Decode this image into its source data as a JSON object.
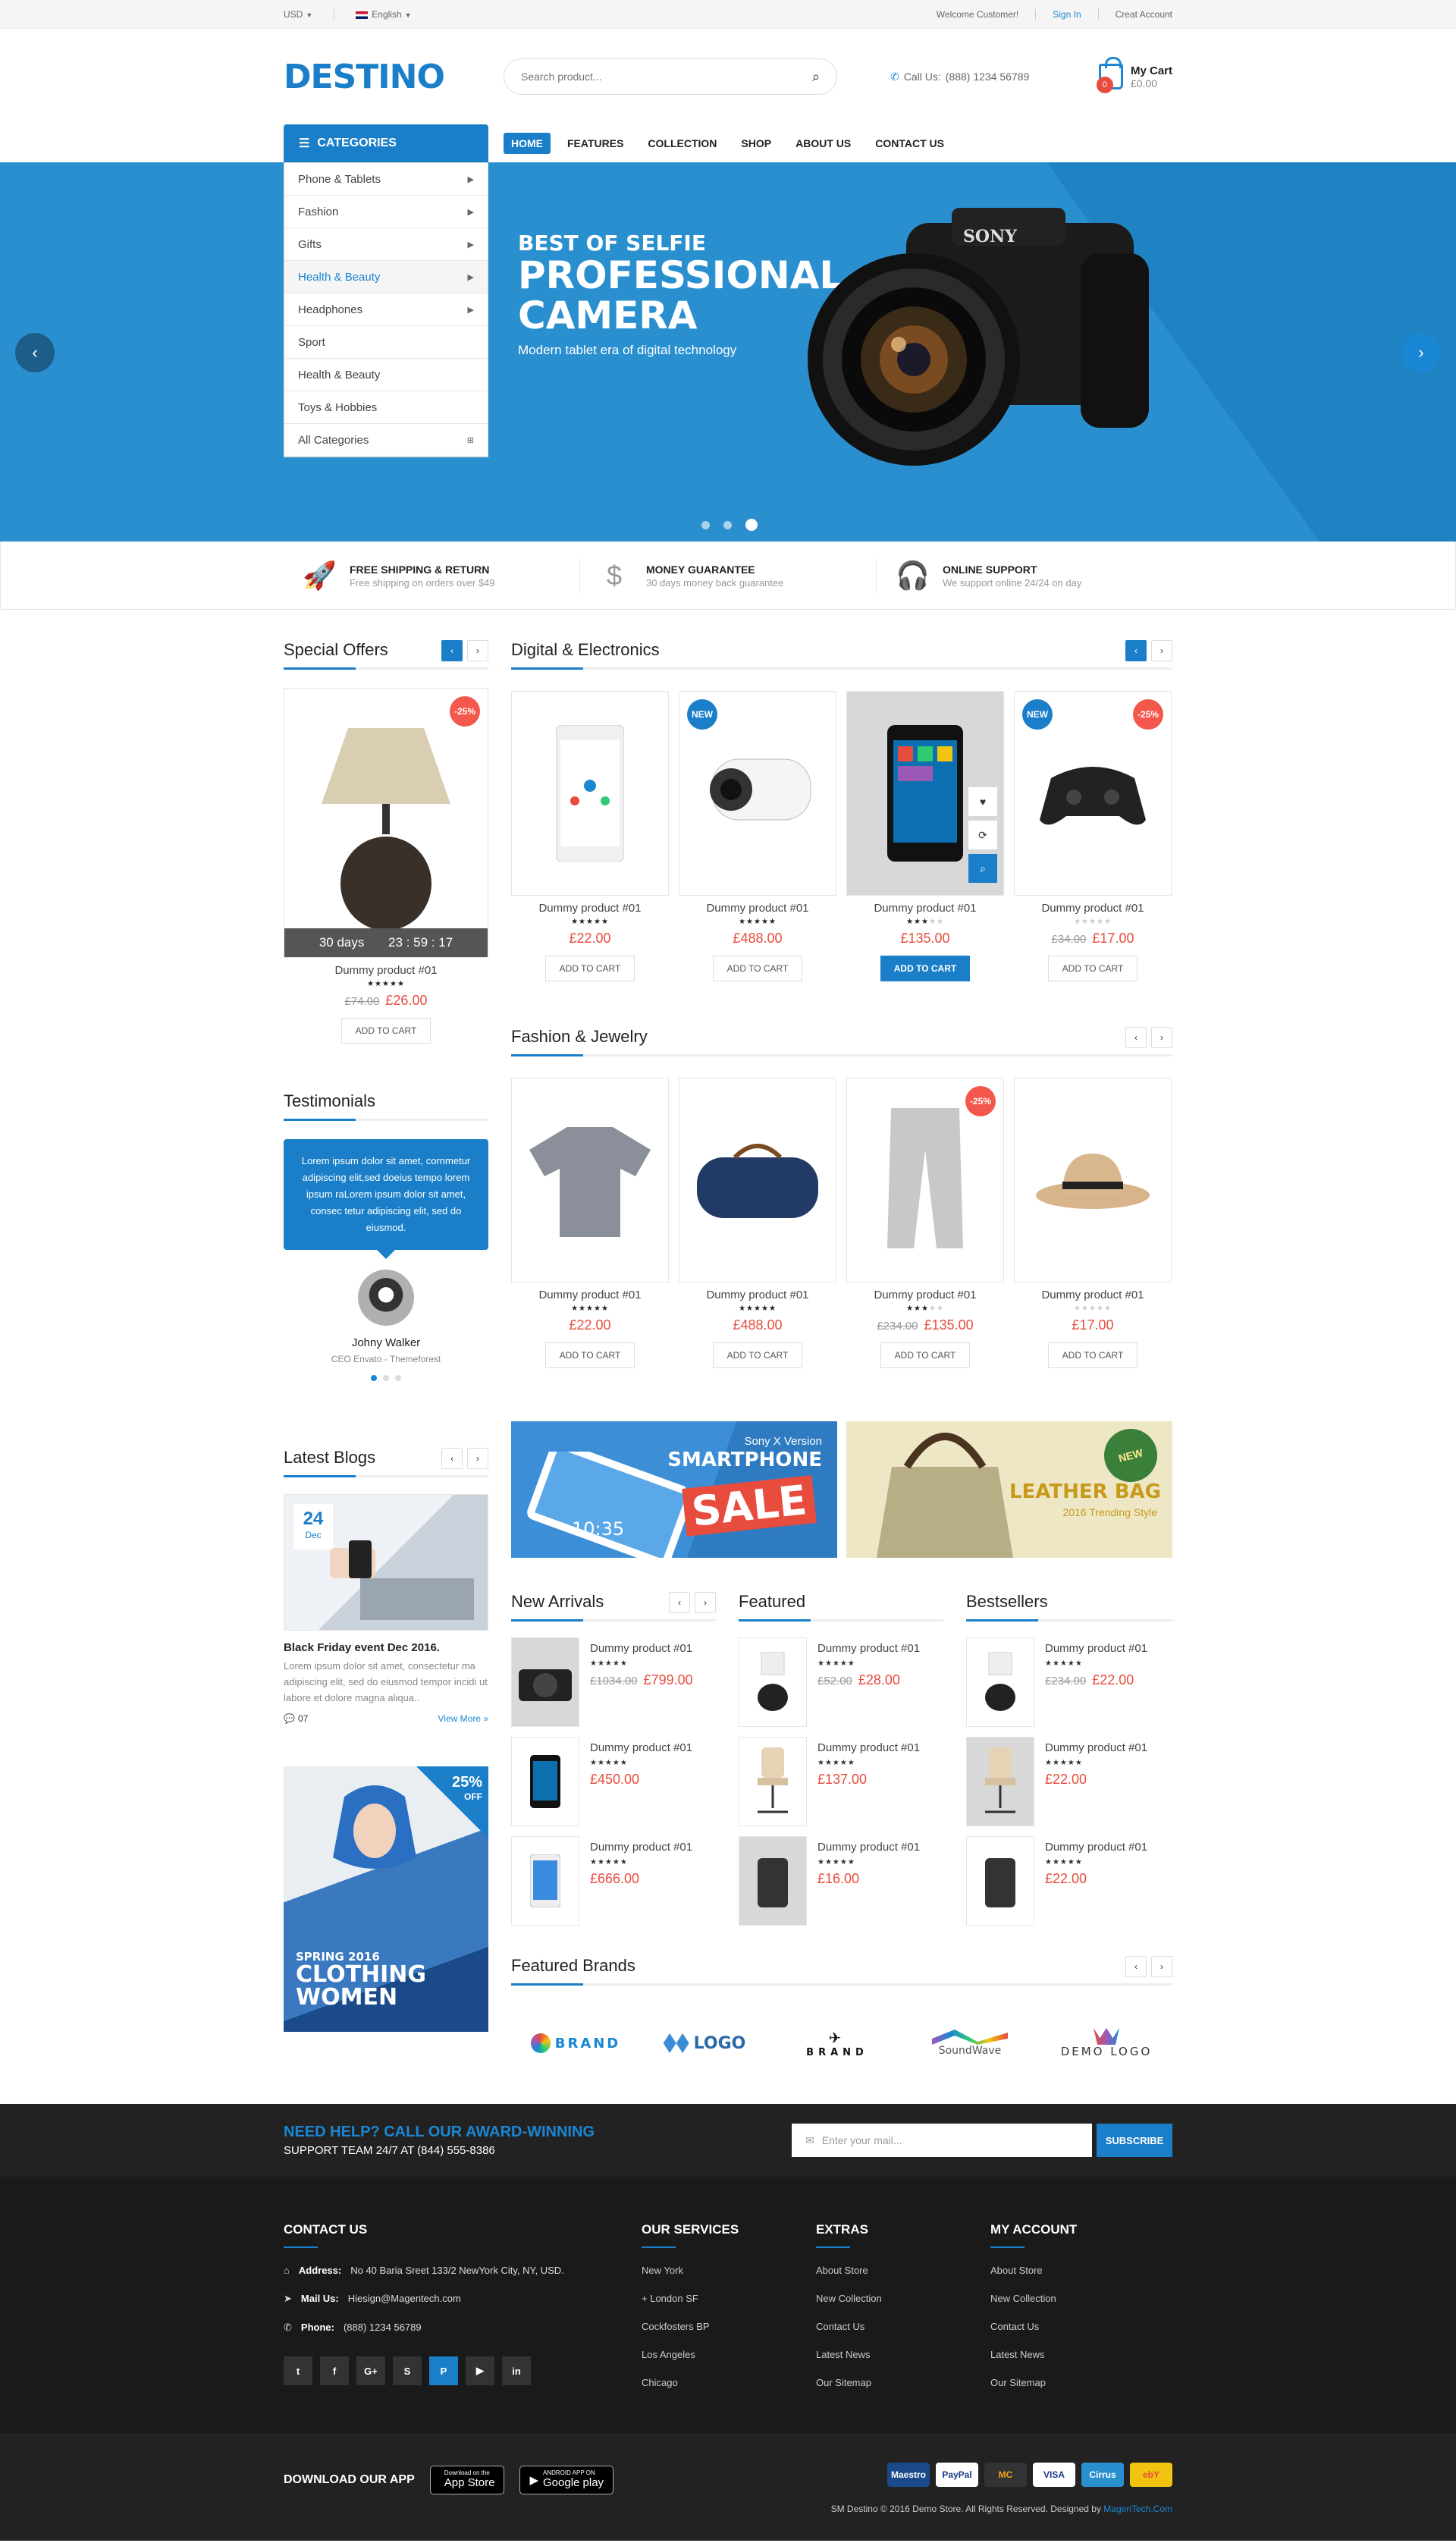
{
  "topbar": {
    "currency": "USD",
    "language": "English",
    "welcome": "Welcome Customer!",
    "signin": "Sign In",
    "create": "Creat Account"
  },
  "header": {
    "logo": "DESTINO",
    "search_placeholder": "Search product...",
    "call_label": "Call Us:",
    "phone": "(888) 1234 56789",
    "cart_title": "My Cart",
    "cart_total": "£0.00",
    "cart_count": "0"
  },
  "nav": {
    "categories_label": "CATEGORIES",
    "menu": [
      "HOME",
      "FEATURES",
      "COLLECTION",
      "SHOP",
      "ABOUT US",
      "CONTACT US"
    ]
  },
  "categories": [
    "Phone & Tablets",
    "Fashion",
    "Gifts",
    "Health & Beauty",
    "Headphones",
    "Sport",
    "Health & Beauty",
    "Toys & Hobbies",
    "All Categories"
  ],
  "slider": {
    "line1": "BEST OF SELFIE",
    "line2": "PROFESSIONAL",
    "line3": "CAMERA",
    "sub": "Modern tablet era of digital technology",
    "camera_brand": "SONY"
  },
  "services": [
    {
      "title": "FREE SHIPPING & RETURN",
      "desc": "Free shipping on orders over $49",
      "icon": "rocket-icon"
    },
    {
      "title": "MONEY GUARANTEE",
      "desc": "30 days money back guarantee",
      "icon": "money-bag-icon"
    },
    {
      "title": "ONLINE SUPPORT",
      "desc": "We support online 24/24 on day",
      "icon": "headphones-icon"
    }
  ],
  "special": {
    "title": "Special Offers",
    "badge": "-25%",
    "days": "30 days",
    "h": "23",
    "m": "59",
    "s": "17",
    "name": "Dummy product #01",
    "old": "£74.00",
    "price": "£26.00",
    "btn": "ADD TO CART"
  },
  "digital": {
    "title": "Digital & Electronics",
    "products": [
      {
        "name": "Dummy product #01",
        "price": "£22.00",
        "old": "",
        "rating": 5,
        "new": "",
        "sale": "",
        "btn": "ADD TO CART"
      },
      {
        "name": "Dummy product #01",
        "price": "£488.00",
        "old": "",
        "rating": 5,
        "new": "NEW",
        "sale": "",
        "btn": "ADD TO CART"
      },
      {
        "name": "Dummy product #01",
        "price": "£135.00",
        "old": "",
        "rating": 3,
        "new": "",
        "sale": "",
        "btn": "ADD TO CART"
      },
      {
        "name": "Dummy product #01",
        "price": "£17.00",
        "old": "£34.00",
        "rating": 0,
        "new": "NEW",
        "sale": "-25%",
        "btn": "ADD TO CART"
      }
    ]
  },
  "fashion": {
    "title": "Fashion & Jewelry",
    "products": [
      {
        "name": "Dummy product #01",
        "price": "£22.00",
        "old": "",
        "rating": 5,
        "sale": "",
        "btn": "ADD TO CART"
      },
      {
        "name": "Dummy product #01",
        "price": "£488.00",
        "old": "",
        "rating": 5,
        "sale": "",
        "btn": "ADD TO CART"
      },
      {
        "name": "Dummy product #01",
        "price": "£135.00",
        "old": "£234.00",
        "rating": 3,
        "sale": "-25%",
        "btn": "ADD TO CART"
      },
      {
        "name": "Dummy product #01",
        "price": "£17.00",
        "old": "",
        "rating": 0,
        "sale": "",
        "btn": "ADD TO CART"
      }
    ]
  },
  "testimonials": {
    "title": "Testimonials",
    "text": "Lorem ipsum dolor sit amet, cornmetur adipiscing elit,sed doeius tempo lorem ipsum raLorem ipsum dolor sit amet, consec tetur adipiscing elit, sed do eiusmod.",
    "name": "Johny Walker",
    "role": "CEO Envato - Themeforest"
  },
  "blogs": {
    "title": "Latest Blogs",
    "day": "24",
    "month": "Dec",
    "post_title": "Black Friday event Dec 2016.",
    "excerpt": "Lorem ipsum dolor sit amet, consectetur ma adipiscing elit, sed do eiusmod tempor incidi ut labore et dolore magna aliqua..",
    "comments": "07",
    "more": "View More »"
  },
  "promo": {
    "pct": "25%",
    "off": "OFF",
    "l1": "SPRING 2016",
    "l2": "CLOTHING",
    "l3": "WOMEN"
  },
  "banner1": {
    "small": "Sony X Version",
    "big": "SMARTPHONE",
    "sale": "SALE",
    "time": "10:35"
  },
  "banner2": {
    "big": "LEATHER BAG",
    "sub": "2016 Trending Style",
    "badge": "NEW"
  },
  "lists": [
    {
      "title": "New Arrivals",
      "items": [
        {
          "name": "Dummy product #01",
          "old": "£1034.00",
          "price": "£799.00"
        },
        {
          "name": "Dummy product #01",
          "old": "",
          "price": "£450.00"
        },
        {
          "name": "Dummy product #01",
          "old": "",
          "price": "£666.00"
        }
      ]
    },
    {
      "title": "Featured",
      "items": [
        {
          "name": "Dummy product #01",
          "old": "£52.00",
          "price": "£28.00"
        },
        {
          "name": "Dummy product #01",
          "old": "",
          "price": "£137.00"
        },
        {
          "name": "Dummy product #01",
          "old": "",
          "price": "£16.00"
        }
      ]
    },
    {
      "title": "Bestsellers",
      "items": [
        {
          "name": "Dummy product #01",
          "old": "£234.00",
          "price": "£22.00"
        },
        {
          "name": "Dummy product #01",
          "old": "",
          "price": "£22.00"
        },
        {
          "name": "Dummy product #01",
          "old": "",
          "price": "£22.00"
        }
      ]
    }
  ],
  "brands": {
    "title": "Featured Brands",
    "items": [
      "BRAND",
      "LOGO",
      "BRAND",
      "SoundWave",
      "DEMO LOGO"
    ]
  },
  "newsletter": {
    "heading": "NEED HELP? CALL OUR AWARD-WINNING",
    "sub": "SUPPORT TEAM 24/7 AT (844) 555-8386",
    "placeholder": "Enter your mail...",
    "btn": "SUBSCRIBE"
  },
  "footer": {
    "contact": {
      "title": "CONTACT US",
      "address_label": "Address:",
      "address": "No 40 Baria Sreet 133/2 NewYork City, NY, USD.",
      "mail_label": "Mail Us:",
      "mail": "Hiesign@Magentech.com",
      "phone_label": "Phone:",
      "phone": "(888) 1234 56789"
    },
    "socials": [
      "t",
      "f",
      "G+",
      "S",
      "P",
      "▶",
      "in"
    ],
    "services": {
      "title": "OUR SERVICES",
      "links": [
        "New York",
        "London SF",
        "Cockfosters BP",
        "Los Angeles",
        "Chicago"
      ]
    },
    "extras": {
      "title": "EXTRAS",
      "links": [
        "About Store",
        "New Collection",
        "Contact Us",
        "Latest News",
        "Our Sitemap"
      ]
    },
    "account": {
      "title": "MY ACCOUNT",
      "links": [
        "About Store",
        "New Collection",
        "Contact Us",
        "Latest News",
        "Our Sitemap"
      ]
    },
    "app_title": "DOWNLOAD OUR APP",
    "app1_small": "Download on the",
    "app1": "App Store",
    "app2_small": "ANDROID APP ON",
    "app2": "Google play",
    "payments": [
      "Maestro",
      "PayPal",
      "MC",
      "VISA",
      "Cirrus",
      "ebY"
    ],
    "copyright": "SM Destino © 2016 Demo Store. All Rights Reserved. Designed by",
    "designer": "MagenTech.Com"
  },
  "colors": {
    "brand": "#1a7fc8",
    "sale": "#e84c3d"
  }
}
